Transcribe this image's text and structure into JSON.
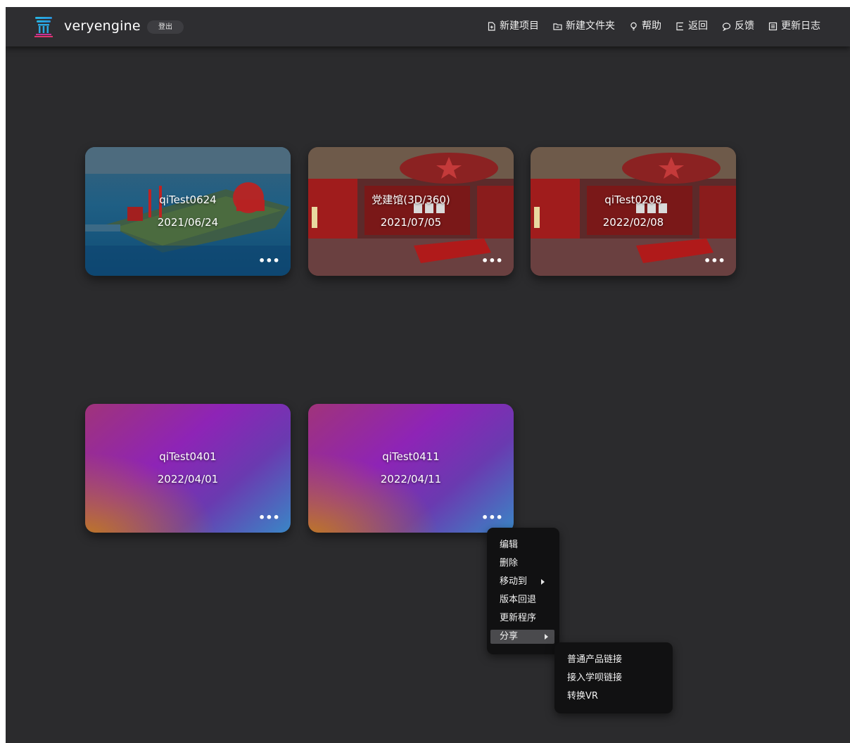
{
  "header": {
    "brand": "veryengine",
    "logout_label": "登出",
    "nav": [
      {
        "label": "新建项目",
        "icon": "new-file-icon"
      },
      {
        "label": "新建文件夹",
        "icon": "new-folder-icon"
      },
      {
        "label": "帮助",
        "icon": "lightbulb-icon"
      },
      {
        "label": "返回",
        "icon": "return-icon"
      },
      {
        "label": "反馈",
        "icon": "chat-bubble-icon"
      },
      {
        "label": "更新日志",
        "icon": "log-icon"
      }
    ]
  },
  "projects": [
    {
      "title": "qiTest0624",
      "date": "2021/06/24",
      "thumbnail": "ocean-platform-scene"
    },
    {
      "title": "党建馆(3D/360)",
      "date": "2021/07/05",
      "thumbnail": "red-exhibition-hall"
    },
    {
      "title": "qiTest0208",
      "date": "2022/02/08",
      "thumbnail": "red-exhibition-hall"
    },
    {
      "title": "qiTest0401",
      "date": "2022/04/01",
      "thumbnail": "gradient"
    },
    {
      "title": "qiTest0411",
      "date": "2022/04/11",
      "thumbnail": "gradient"
    }
  ],
  "more_label": "•••",
  "context_menu": {
    "items": [
      "编辑",
      "删除",
      "移动到",
      "版本回退",
      "更新程序",
      "分享"
    ],
    "active": "分享"
  },
  "share_submenu": {
    "items": [
      "普通产品链接",
      "接入学呗链接",
      "转换VR"
    ]
  },
  "colors": {
    "background": "#2b2b2d",
    "header": "#2e2e31",
    "menu": "#111112",
    "menu_active": "#4a4a4d"
  }
}
